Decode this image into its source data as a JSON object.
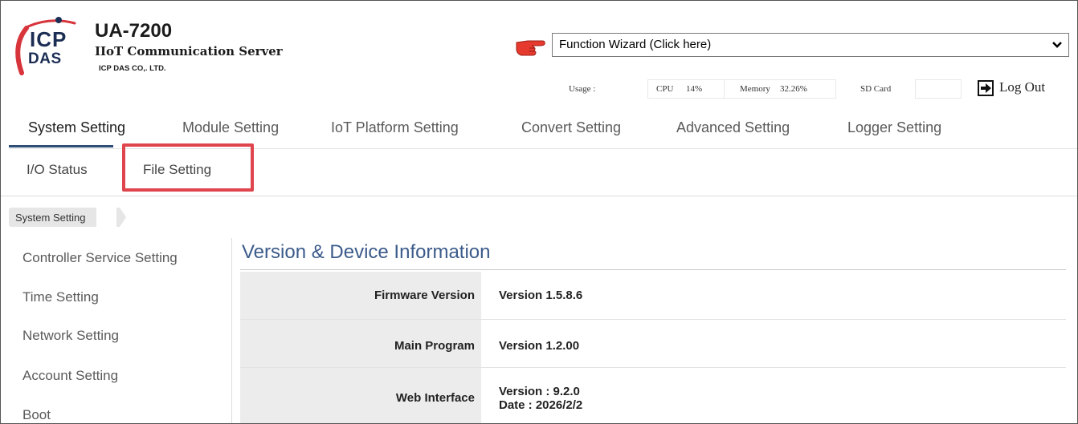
{
  "header": {
    "logo_line1": "ICP",
    "logo_line2": "DAS",
    "model": "UA-7200",
    "subtitle": "IIoT Communication Server",
    "company": "ICP DAS CO,. LTD.",
    "wizard_value": "Function Wizard  (Click here)",
    "usage_label": "Usage :",
    "cpu_label": "CPU",
    "cpu_value": "14%",
    "memory_label": "Memory",
    "memory_value": "32.26%",
    "sd_label": "SD Card",
    "sd_value": "",
    "logout_label": "Log Out"
  },
  "main_nav": [
    {
      "label": "System Setting",
      "active": true
    },
    {
      "label": "Module Setting"
    },
    {
      "label": "IoT Platform Setting"
    },
    {
      "label": "Convert Setting"
    },
    {
      "label": "Advanced Setting"
    },
    {
      "label": "Logger Setting"
    }
  ],
  "sub_nav": [
    {
      "label": "I/O Status"
    },
    {
      "label": "File Setting",
      "highlighted": true
    }
  ],
  "breadcrumb": "System Setting",
  "sidebar": [
    {
      "label": "Controller Service Setting"
    },
    {
      "label": "Time Setting"
    },
    {
      "label": "Network Setting"
    },
    {
      "label": "Account Setting"
    },
    {
      "label": "Boot"
    }
  ],
  "content": {
    "title": "Version & Device Information",
    "rows": [
      {
        "label": "Firmware Version",
        "value": "Version 1.5.8.6"
      },
      {
        "label": "Main Program",
        "value": "Version 1.2.00"
      },
      {
        "label": "Web Interface",
        "value_line1": "Version : 9.2.0",
        "value_line2": "Date : 2026/2/2"
      }
    ]
  },
  "colors": {
    "accent_blue": "#3b5b8a",
    "nav_underline": "#2e4e7a",
    "highlight_red": "#e0444c",
    "logo_red": "#d7343b",
    "logo_navy": "#1c2e55"
  },
  "icons": {
    "logo": "icp-das-logo",
    "wizard_pointer": "pointing-hand-icon",
    "wizard_dropdown": "chevron-down-icon",
    "logout": "logout-icon"
  }
}
